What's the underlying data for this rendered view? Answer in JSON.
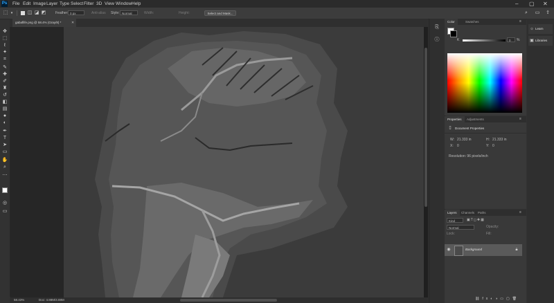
{
  "app": {
    "logo_text": "Ps"
  },
  "menu": [
    "File",
    "Edit",
    "Image",
    "Layer",
    "Type",
    "Select",
    "Filter",
    "3D",
    "View",
    "Window",
    "Help"
  ],
  "window_controls": {
    "minimize": "–",
    "maximize": "▢",
    "close": "✕"
  },
  "options_bar": {
    "feather_label": "Feather:",
    "feather_value": "0 px",
    "antialias_label": "Anti-alias",
    "style_label": "Style:",
    "style_value": "Normal",
    "width_label": "Width:",
    "height_label": "Height:",
    "select_mask_button": "Select and Mask..."
  },
  "document": {
    "tab_label": "gabaflife.png @ 58.4% (Gray/8) *",
    "zoom": "58.43%",
    "doc_size": "Doc: 4.88M/4.88M"
  },
  "tools": [
    {
      "name": "move-tool",
      "glyph": "✥"
    },
    {
      "name": "marquee-tool",
      "glyph": "⬚"
    },
    {
      "name": "lasso-tool",
      "glyph": "ℓ"
    },
    {
      "name": "magic-wand-tool",
      "glyph": "✦"
    },
    {
      "name": "crop-tool",
      "glyph": "⌗"
    },
    {
      "name": "eyedropper-tool",
      "glyph": "✎"
    },
    {
      "name": "healing-brush-tool",
      "glyph": "✚"
    },
    {
      "name": "brush-tool",
      "glyph": "✐"
    },
    {
      "name": "clone-stamp-tool",
      "glyph": "♜"
    },
    {
      "name": "history-brush-tool",
      "glyph": "↺"
    },
    {
      "name": "eraser-tool",
      "glyph": "◧"
    },
    {
      "name": "gradient-tool",
      "glyph": "▤"
    },
    {
      "name": "blur-tool",
      "glyph": "●"
    },
    {
      "name": "dodge-tool",
      "glyph": "◐"
    },
    {
      "name": "pen-tool",
      "glyph": "✒"
    },
    {
      "name": "type-tool",
      "glyph": "T"
    },
    {
      "name": "path-selection-tool",
      "glyph": "➤"
    },
    {
      "name": "rectangle-tool",
      "glyph": "▭"
    },
    {
      "name": "hand-tool",
      "glyph": "✋"
    },
    {
      "name": "zoom-tool",
      "glyph": "⌕"
    },
    {
      "name": "more-tools",
      "glyph": "⋯"
    }
  ],
  "color_panel": {
    "tabs": [
      "Color",
      "Swatches"
    ],
    "k_label": "K",
    "k_value": "0",
    "k_unit": "%"
  },
  "properties_panel": {
    "tabs": [
      "Properties",
      "Adjustments"
    ],
    "title": "Document Properties",
    "w_label": "W:",
    "w_value": "21.333 in",
    "h_label": "H:",
    "h_value": "21.333 in",
    "x_label": "X:",
    "x_value": "0",
    "y_label": "Y:",
    "y_value": "0",
    "resolution": "Resolution: 96 pixels/inch"
  },
  "layers_panel": {
    "tabs": [
      "Layers",
      "Channels",
      "Paths"
    ],
    "filter_label": "Kind",
    "blend_mode": "Normal",
    "opacity_label": "Opacity:",
    "lock_label": "Lock:",
    "fill_label": "Fill:",
    "layer_name": "Background"
  },
  "right_dock": {
    "learn": "Learn",
    "libraries": "Libraries"
  },
  "colors": {
    "ui_bg": "#323232",
    "panel_bg": "#393939",
    "accent": "#31a8ff"
  }
}
